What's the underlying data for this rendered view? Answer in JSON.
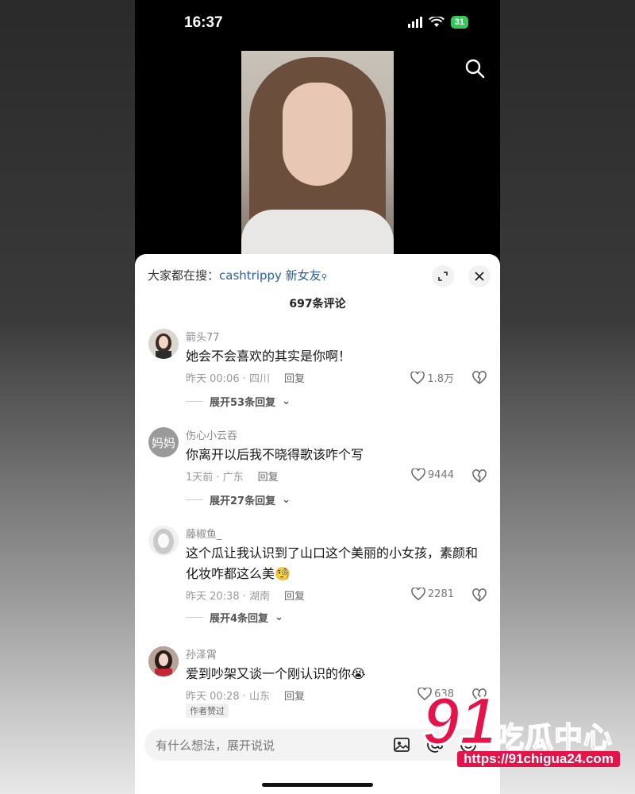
{
  "status_bar": {
    "time": "16:37",
    "battery": "31"
  },
  "top": {
    "search_icon": "search-icon"
  },
  "sheet": {
    "hot_search_prefix": "大家都在搜：",
    "hot_search_link": "cashtrippy 新女友",
    "expand_icon": "expand-icon",
    "close_icon": "close-icon",
    "comment_count": "697条评论"
  },
  "comments": [
    {
      "username": "箭头77",
      "content": "她会不会喜欢的其实是你啊！",
      "time_location": "昨天 00:06 · 四川",
      "reply": "回复",
      "likes": "1.8万",
      "expand": "展开53条回复"
    },
    {
      "username": "伤心小云吞",
      "avatar_text": "妈妈",
      "content": "你离开以后我不晓得歌该咋个写",
      "time_location": "1天前 · 广东",
      "reply": "回复",
      "likes": "9444",
      "expand": "展开27条回复"
    },
    {
      "username": "藤椒鱼_",
      "content": "这个瓜让我认识到了山口这个美丽的小女孩，素颜和化妆咋都这么美🧐",
      "time_location": "昨天 20:38 · 湖南",
      "reply": "回复",
      "likes": "2281",
      "expand": "展开4条回复"
    },
    {
      "username": "孙泽霄",
      "content": "爱到吵架又谈一个刚认识的你😭",
      "time_location": "昨天 00:28 · 山东",
      "reply": "回复",
      "likes": "638",
      "badge": "作者赞过"
    }
  ],
  "input": {
    "placeholder": "有什么想法，展开说说"
  },
  "watermark": {
    "number": "91",
    "name": "吃瓜中心",
    "url": "https://91chigua24.com"
  },
  "colors": {
    "accent": "#e4134a",
    "link": "#2a5fa0",
    "battery": "#34c759"
  }
}
